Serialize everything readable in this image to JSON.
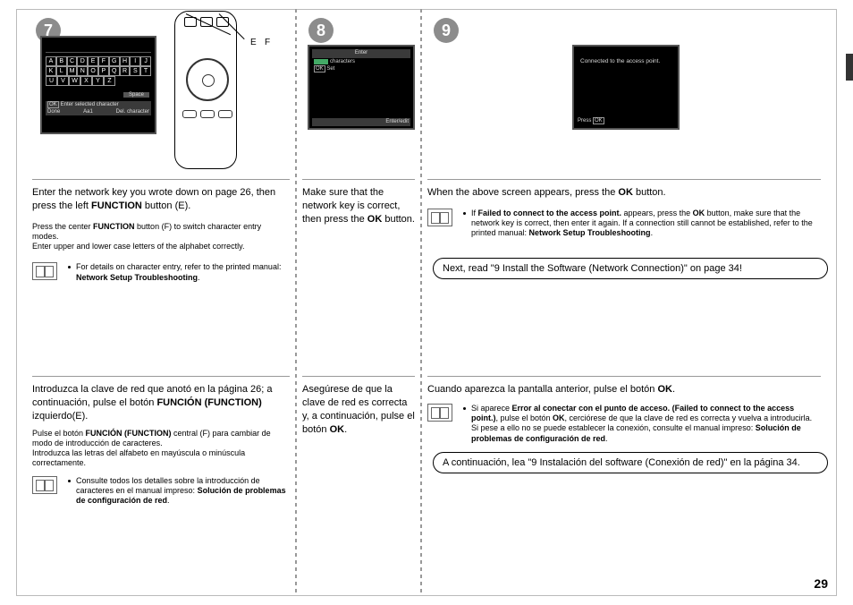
{
  "badges": {
    "s7": "7",
    "s8": "8",
    "s9": "9"
  },
  "labels": {
    "E": "E",
    "F": "F"
  },
  "lcd7": {
    "rows": [
      [
        "A",
        "B",
        "C",
        "D",
        "E",
        "F",
        "G",
        "H",
        "I",
        "J"
      ],
      [
        "K",
        "L",
        "M",
        "N",
        "O",
        "P",
        "Q",
        "R",
        "S",
        "T"
      ],
      [
        "U",
        "V",
        "W",
        "X",
        "Y",
        "Z"
      ]
    ],
    "space": "Space",
    "ok": "OK",
    "okline": "Enter selected character",
    "done": "Done",
    "mode": "Aa1",
    "del": "Del. character"
  },
  "lcd8": {
    "title": "Enter",
    "line2": "characters",
    "ok": "OK",
    "set": "Set",
    "bottom": "Enter/edit"
  },
  "lcd9": {
    "msg": "Connected to the access point.",
    "press": "Press",
    "ok": "OK"
  },
  "s7": {
    "en": {
      "p1a": "Enter the network key you wrote down on page 26, then press the left ",
      "p1b": "FUNCTION",
      "p1c": " button (E).",
      "n1a": "Press the center ",
      "n1b": "FUNCTION",
      "n1c": " button (F) to switch character entry modes.",
      "n2": "Enter upper and lower case letters of the alphabet correctly.",
      "tip1": "For details on character entry, refer to the printed manual: ",
      "tip1b": "Network Setup Troubleshooting",
      "tip1c": "."
    },
    "es": {
      "p1a": "Introduzca la clave de red que anotó en la página 26; a continuación, pulse el botón ",
      "p1b": "FUNCIÓN (FUNCTION)",
      "p1c": " izquierdo(E).",
      "n1a": "Pulse el botón ",
      "n1b": "FUNCIÓN (FUNCTION)",
      "n1c": " central (F) para cambiar de modo de introducción de caracteres.",
      "n2": "Introduzca las letras del alfabeto en mayúscula o minúscula correctamente.",
      "tip1": "Consulte todos los detalles sobre la introducción de caracteres en el manual impreso: ",
      "tip1b": "Solución de problemas de configuración de red",
      "tip1c": "."
    }
  },
  "s8": {
    "en": {
      "p1a": "Make sure that the network key is correct, then press the ",
      "p1b": "OK",
      "p1c": " button."
    },
    "es": {
      "p1a": "Asegúrese de que la clave de red es correcta y, a continuación, pulse el botón ",
      "p1b": "OK",
      "p1c": "."
    }
  },
  "s9": {
    "en": {
      "p1a": "When the above screen appears, press the ",
      "p1b": "OK",
      "p1c": " button.",
      "tip_a": "If ",
      "tip_b": "Failed to connect to the access point.",
      "tip_c": " appears, press the ",
      "tip_d": "OK",
      "tip_e": " button, make sure that the network key is correct, then enter it again. If a connection still cannot be established, refer to the printed manual: ",
      "tip_f": "Network Setup Troubleshooting",
      "tip_g": ".",
      "pill": "Next, read \"9 Install the Software (Network Connection)\" on page 34!"
    },
    "es": {
      "p1a": "Cuando aparezca la pantalla anterior, pulse el botón ",
      "p1b": "OK",
      "p1c": ".",
      "tip_a": "Si aparece ",
      "tip_b": "Error al conectar con el punto de acceso. (Failed to connect to the access point.)",
      "tip_c": ", pulse el botón ",
      "tip_d": "OK",
      "tip_e": ", cerciórese de que la clave de red es correcta y vuelva a introducirla. Si pese a ello no se puede establecer la conexión, consulte el manual impreso: ",
      "tip_f": "Solución de problemas de configuración de red",
      "tip_g": ".",
      "pill": "A continuación, lea \"9 Instalación del software (Conexión de red)\" en la página 34."
    }
  },
  "page": "29"
}
